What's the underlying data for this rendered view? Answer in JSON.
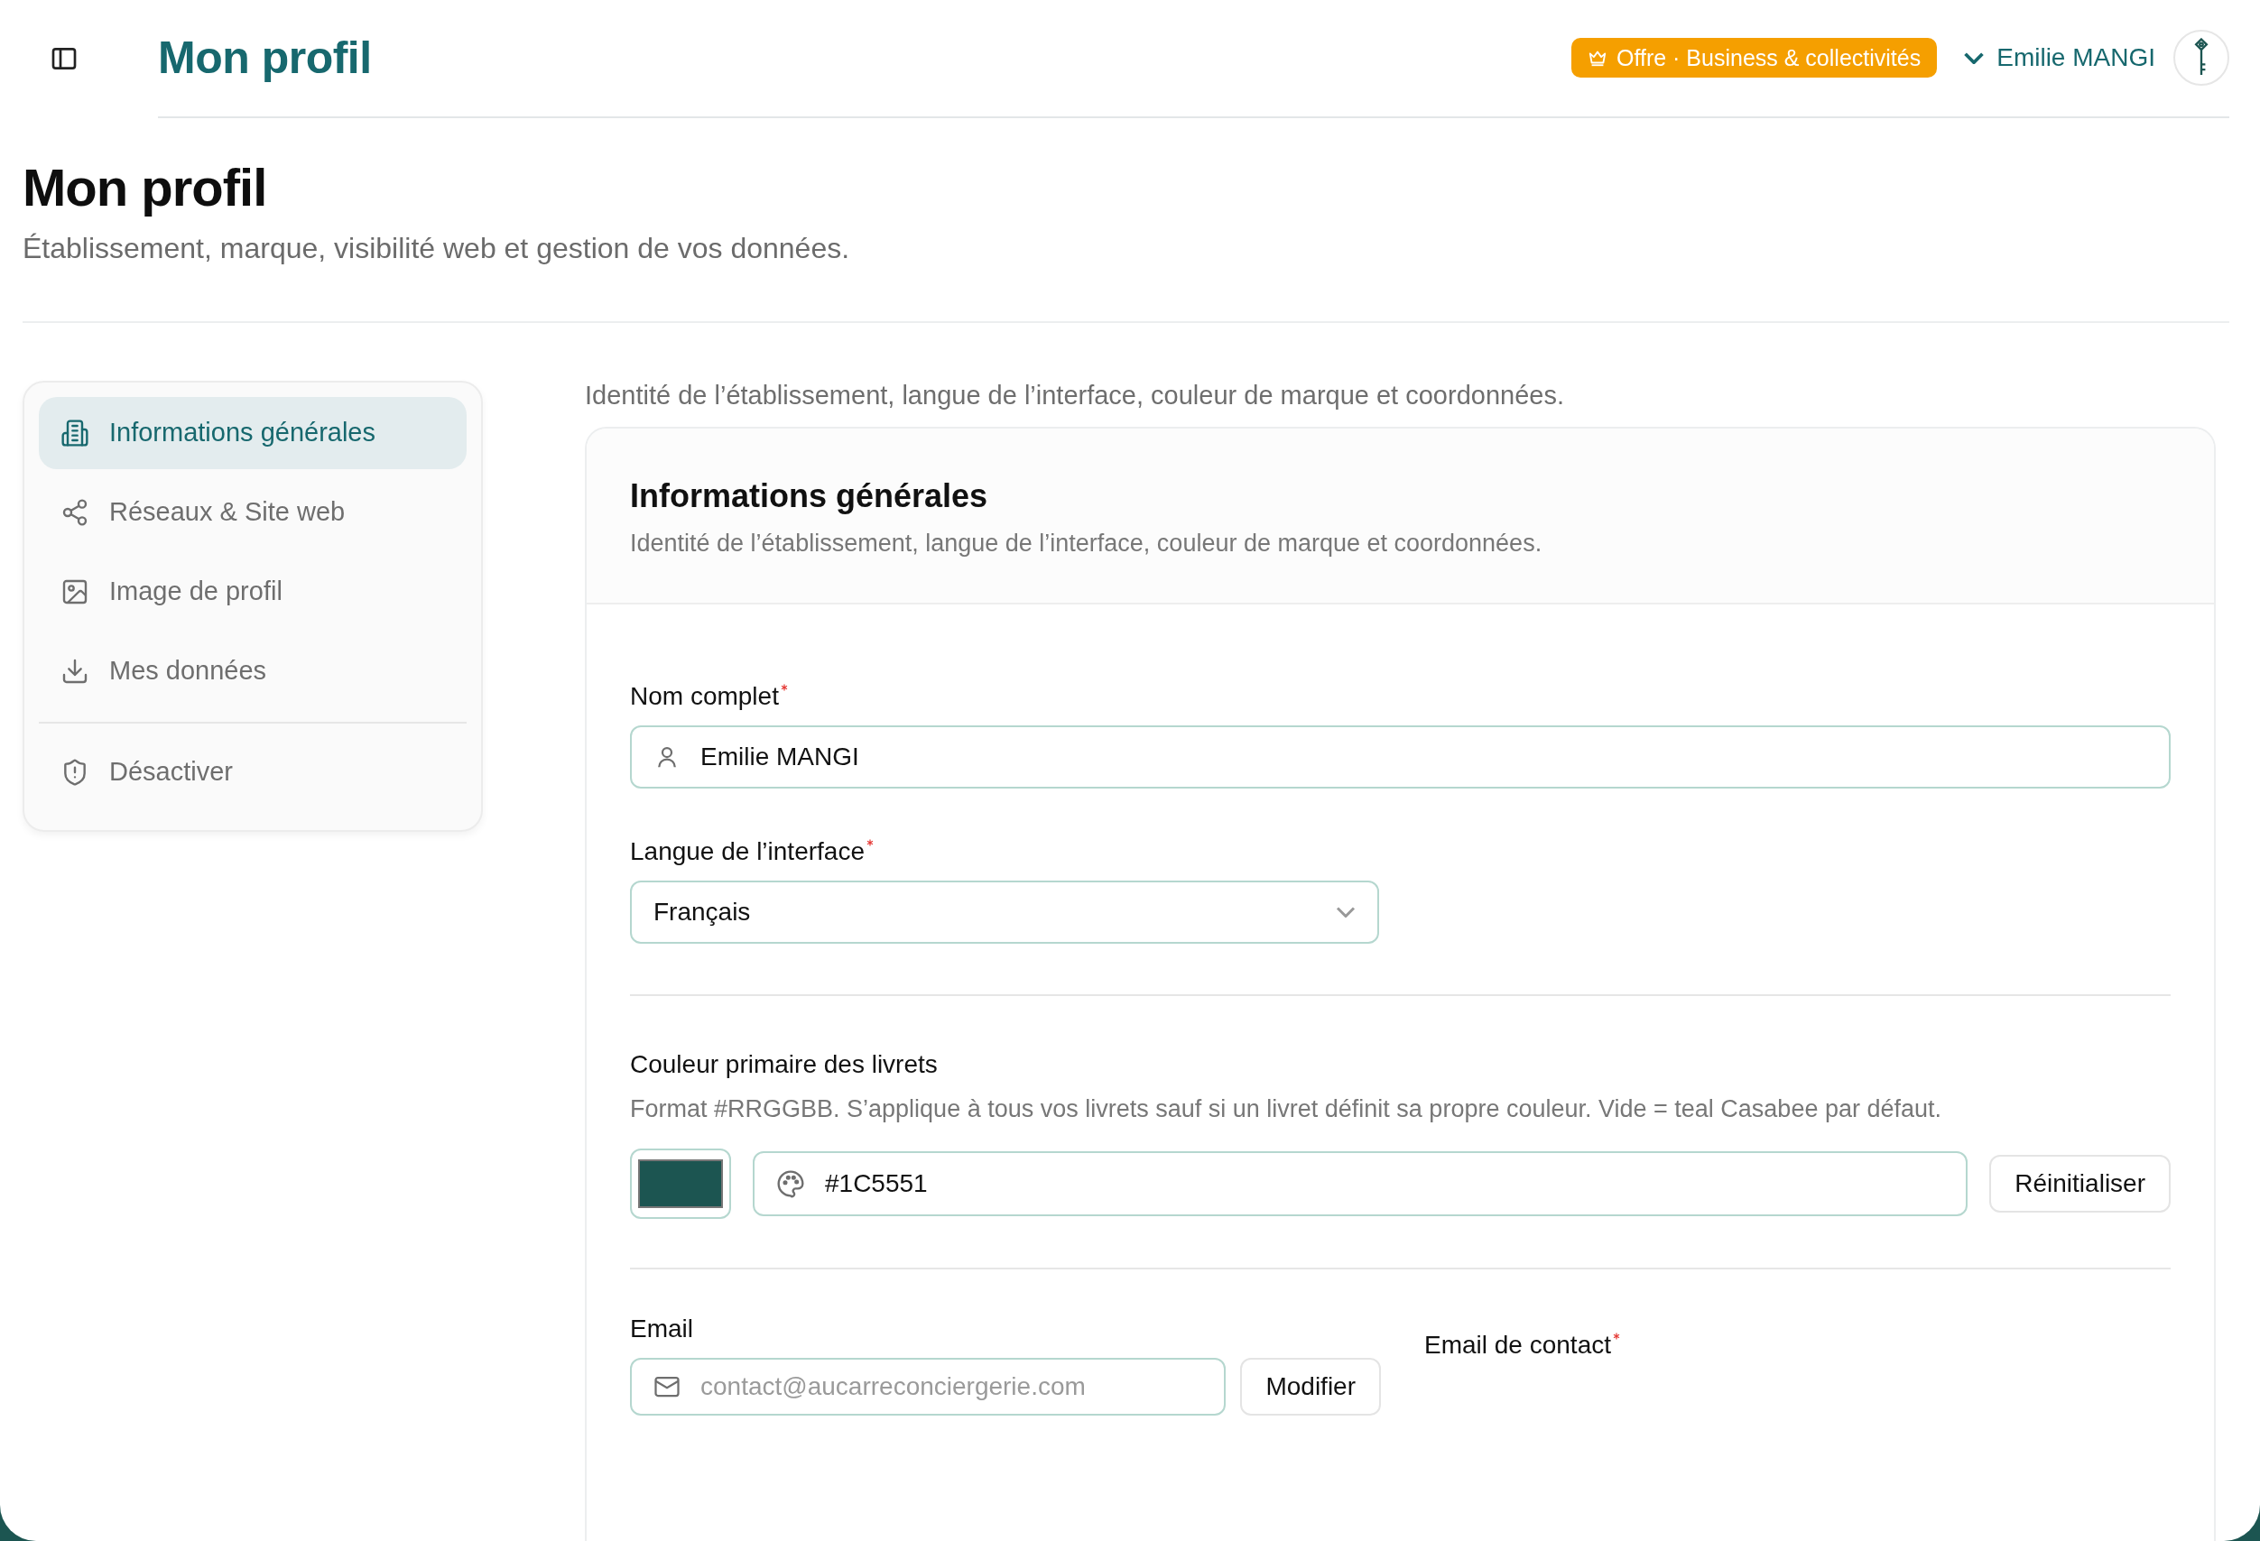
{
  "header": {
    "title": "Mon profil",
    "offer_badge": "Offre · Business & collectivités",
    "user_name": "Emilie MANGI"
  },
  "page": {
    "title": "Mon profil",
    "subtitle": "Établissement, marque, visibilité web et gestion de vos données."
  },
  "sidebar": {
    "items": [
      {
        "label": "Informations générales",
        "selected": true
      },
      {
        "label": "Réseaux & Site web",
        "selected": false
      },
      {
        "label": "Image de profil",
        "selected": false
      },
      {
        "label": "Mes données",
        "selected": false
      }
    ],
    "footer_items": [
      {
        "label": "Désactiver",
        "selected": false
      }
    ]
  },
  "section_intro": "Identité de l’établissement, langue de l’interface, couleur de marque et coordonnées.",
  "card": {
    "title": "Informations générales",
    "description": "Identité de l’établissement, langue de l’interface, couleur de marque et coordonnées.",
    "full_name": {
      "label": "Nom complet",
      "required": true,
      "value": "Emilie MANGI"
    },
    "language": {
      "label": "Langue de l’interface",
      "required": true,
      "value": "Français"
    },
    "primary_color": {
      "label": "Couleur primaire des livrets",
      "help": "Format #RRGGBB. S’applique à tous vos livrets sauf si un livret définit sa propre couleur. Vide = teal Casabee par défaut.",
      "value": "#1C5551",
      "button": "Réinitialiser"
    },
    "email": {
      "label": "Email",
      "value": "contact@aucarreconciergerie.com",
      "disabled": true,
      "button": "Modifier"
    },
    "contact_email": {
      "label": "Email de contact",
      "required": true
    }
  }
}
